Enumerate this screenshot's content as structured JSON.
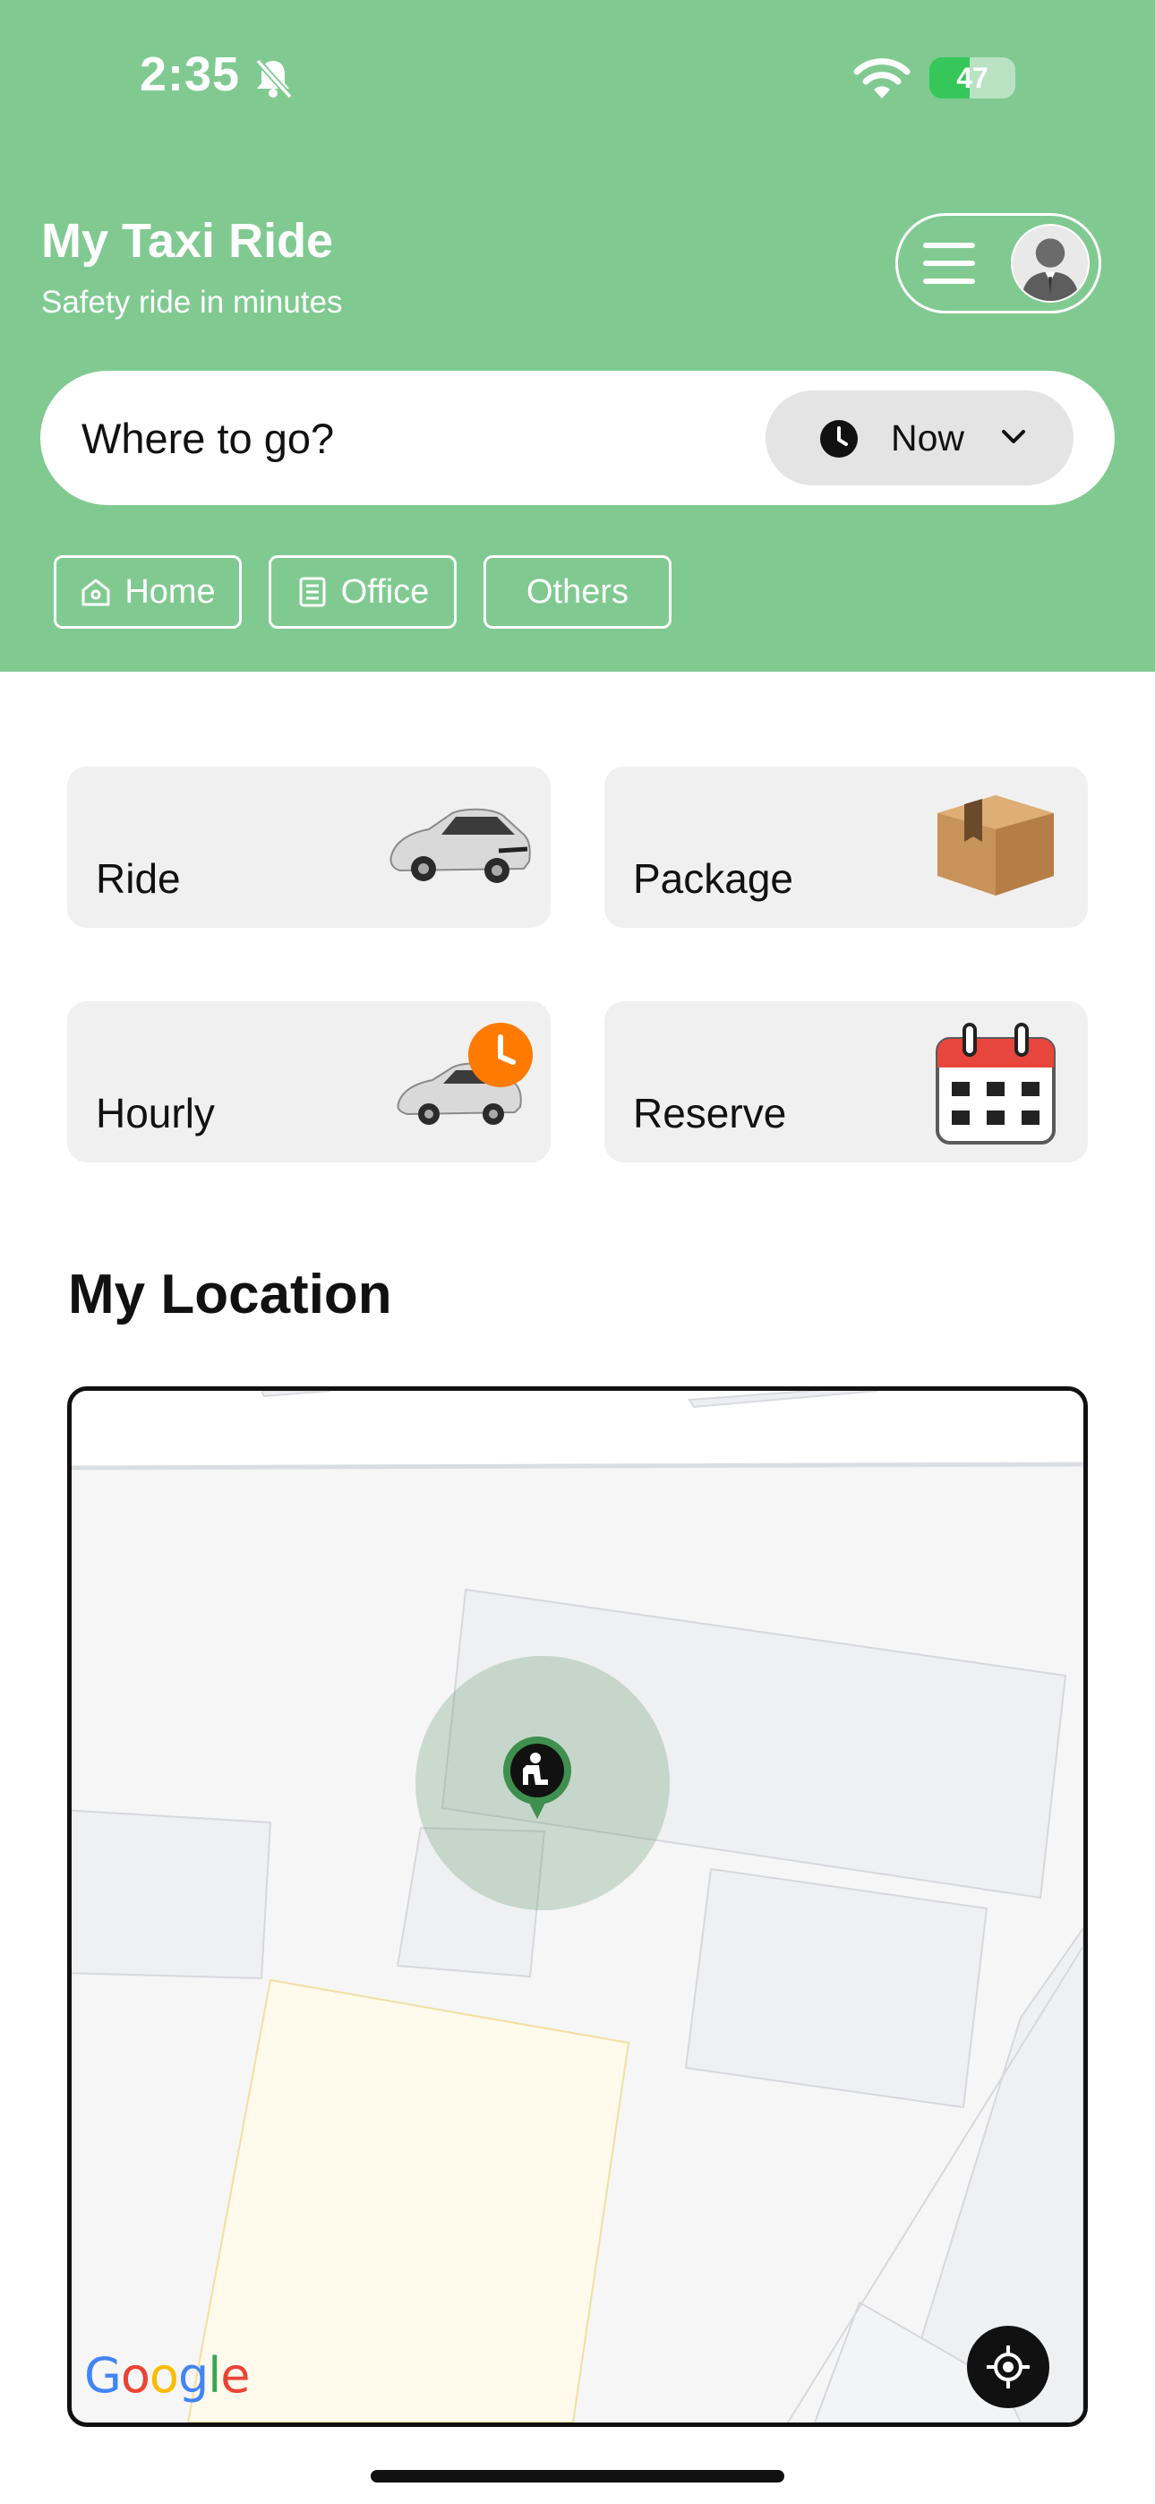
{
  "status_bar": {
    "time": "2:35",
    "battery_level": "47",
    "battery_fraction": 0.47,
    "icons": [
      "bell-slash-icon",
      "wifi-icon",
      "battery-charging-icon"
    ]
  },
  "header": {
    "title": "My Taxi Ride",
    "subtitle": "Safety ride in minutes",
    "background_color": "#80ca91"
  },
  "search": {
    "placeholder": "Where to go?",
    "when_label": "Now"
  },
  "shortcuts": [
    {
      "label": "Home",
      "icon": "home-icon"
    },
    {
      "label": "Office",
      "icon": "building-icon"
    },
    {
      "label": "Others"
    }
  ],
  "services": [
    {
      "label": "Ride",
      "icon": "car-icon"
    },
    {
      "label": "Package",
      "icon": "package-box-icon"
    },
    {
      "label": "Hourly",
      "icon": "car-clock-icon"
    },
    {
      "label": "Reserve",
      "icon": "calendar-icon"
    }
  ],
  "location": {
    "section_title": "My Location",
    "map_attribution": "Google"
  },
  "colors": {
    "accent_green": "#80ca91",
    "card_bg": "#f0f0f0",
    "clock_badge": "#ff7a00",
    "calendar_red": "#e8453c"
  }
}
